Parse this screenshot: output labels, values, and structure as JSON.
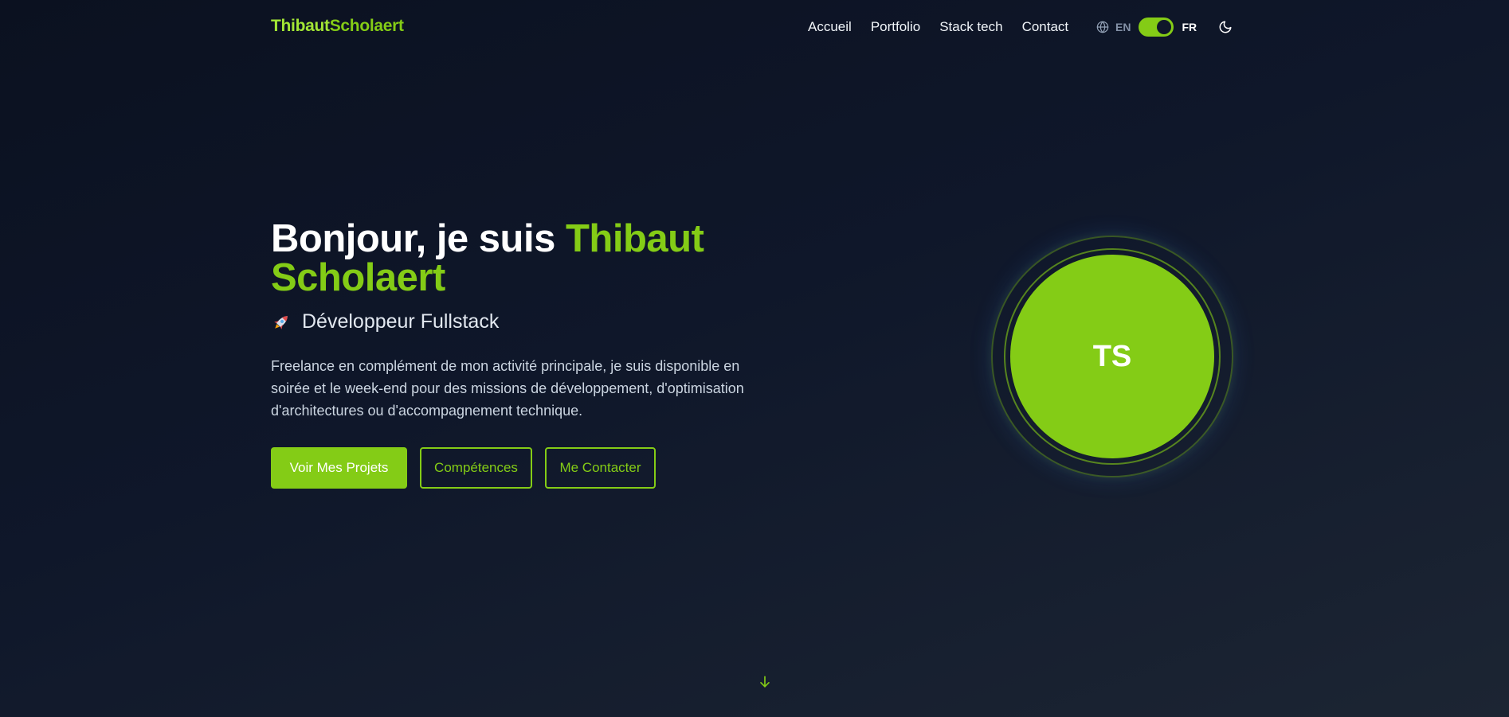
{
  "header": {
    "logo_first": "Thibaut",
    "logo_second": "Scholaert",
    "nav": [
      {
        "label": "Accueil"
      },
      {
        "label": "Portfolio"
      },
      {
        "label": "Stack tech"
      },
      {
        "label": "Contact"
      }
    ],
    "language": {
      "icon": "globe-icon",
      "option_en": "EN",
      "option_fr": "FR",
      "active": "FR"
    },
    "theme_toggle_icon": "moon-icon"
  },
  "hero": {
    "greeting": "Bonjour, je suis",
    "name_line1": "Thibaut",
    "name_line2": "Scholaert",
    "subtitle_icon": "rocket-icon",
    "subtitle": "Développeur Fullstack",
    "description": "Freelance en complément de mon activité principale, je suis disponible en soirée et le week-end pour des missions de développement, d'optimisation d'architectures ou d'accompagnement technique.",
    "buttons": {
      "projects": "Voir Mes Projets",
      "skills": "Compétences",
      "contact": "Me Contacter"
    },
    "avatar_initials": "TS",
    "scroll_icon": "arrow-down-icon"
  },
  "colors": {
    "accent": "#84cc16",
    "background": "#0f172a",
    "text": "#ffffff",
    "muted": "#cbd5e1"
  }
}
